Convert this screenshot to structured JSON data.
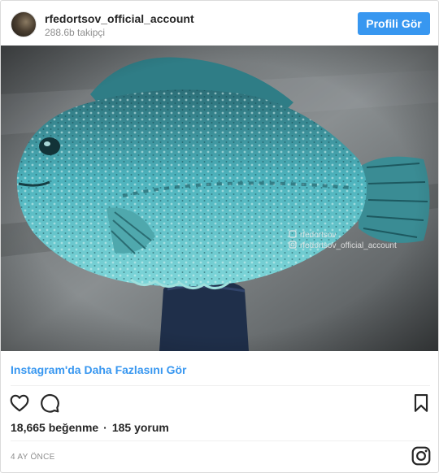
{
  "header": {
    "username": "rfedortsov_official_account",
    "followers": "288.6b takipçi",
    "profile_button": "Profili Gör"
  },
  "photo": {
    "watermark_handle": "rfedortsov",
    "watermark_account": "rfedortsov_official_account"
  },
  "more_link": "Instagram'da Daha Fazlasını Gör",
  "actions": {
    "icons": [
      "heart-icon",
      "comment-icon",
      "bookmark-icon"
    ]
  },
  "stats": {
    "likes": "18,665 beğenme",
    "separator": "·",
    "comments": "185 yorum"
  },
  "timestamp": "4 AY ÖNCE",
  "footer_icon": "instagram-logo-icon",
  "colors": {
    "accent": "#3897f0",
    "text": "#262626",
    "muted": "#8e8e8e",
    "border": "#dbdbdb"
  }
}
